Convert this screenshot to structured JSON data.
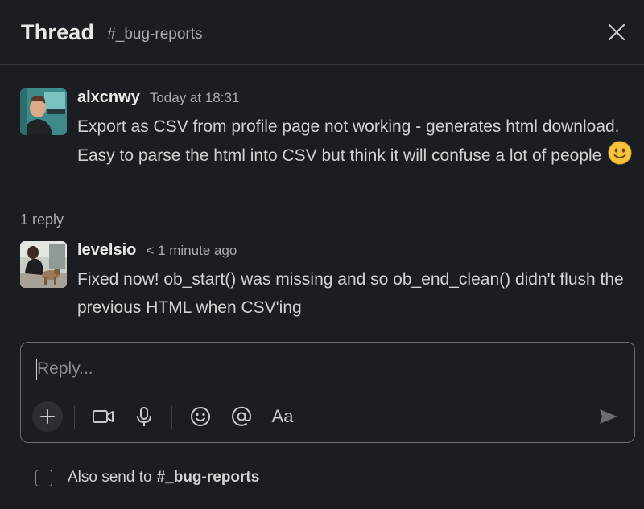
{
  "header": {
    "title": "Thread",
    "channel": "#_bug-reports"
  },
  "messages": [
    {
      "author": "alxcnwy",
      "time": "Today at 18:31",
      "text": "Export as CSV from profile page not working - generates html download. Easy to parse the html into CSV but think it will confuse a lot of people",
      "emoji": "slightly-smiling-face"
    },
    {
      "author": "levelsio",
      "time": "< 1 minute ago",
      "text": "Fixed now! ob_start() was missing and so ob_end_clean() didn't flush the previous HTML when CSV'ing"
    }
  ],
  "thread": {
    "reply_count": "1 reply"
  },
  "composer": {
    "placeholder": "Reply...",
    "value": "",
    "tools": [
      "plus-icon",
      "video-icon",
      "microphone-icon",
      "emoji-icon",
      "mention-icon",
      "formatting-icon",
      "send-icon"
    ],
    "format_label": "Aa"
  },
  "footer": {
    "also_send_label": "Also send to",
    "also_send_channel": "#_bug-reports",
    "checked": false
  },
  "colors": {
    "background": "#1a1d21",
    "text": "#d1d2d3",
    "muted": "#abacae",
    "border": "#6b6d70"
  }
}
